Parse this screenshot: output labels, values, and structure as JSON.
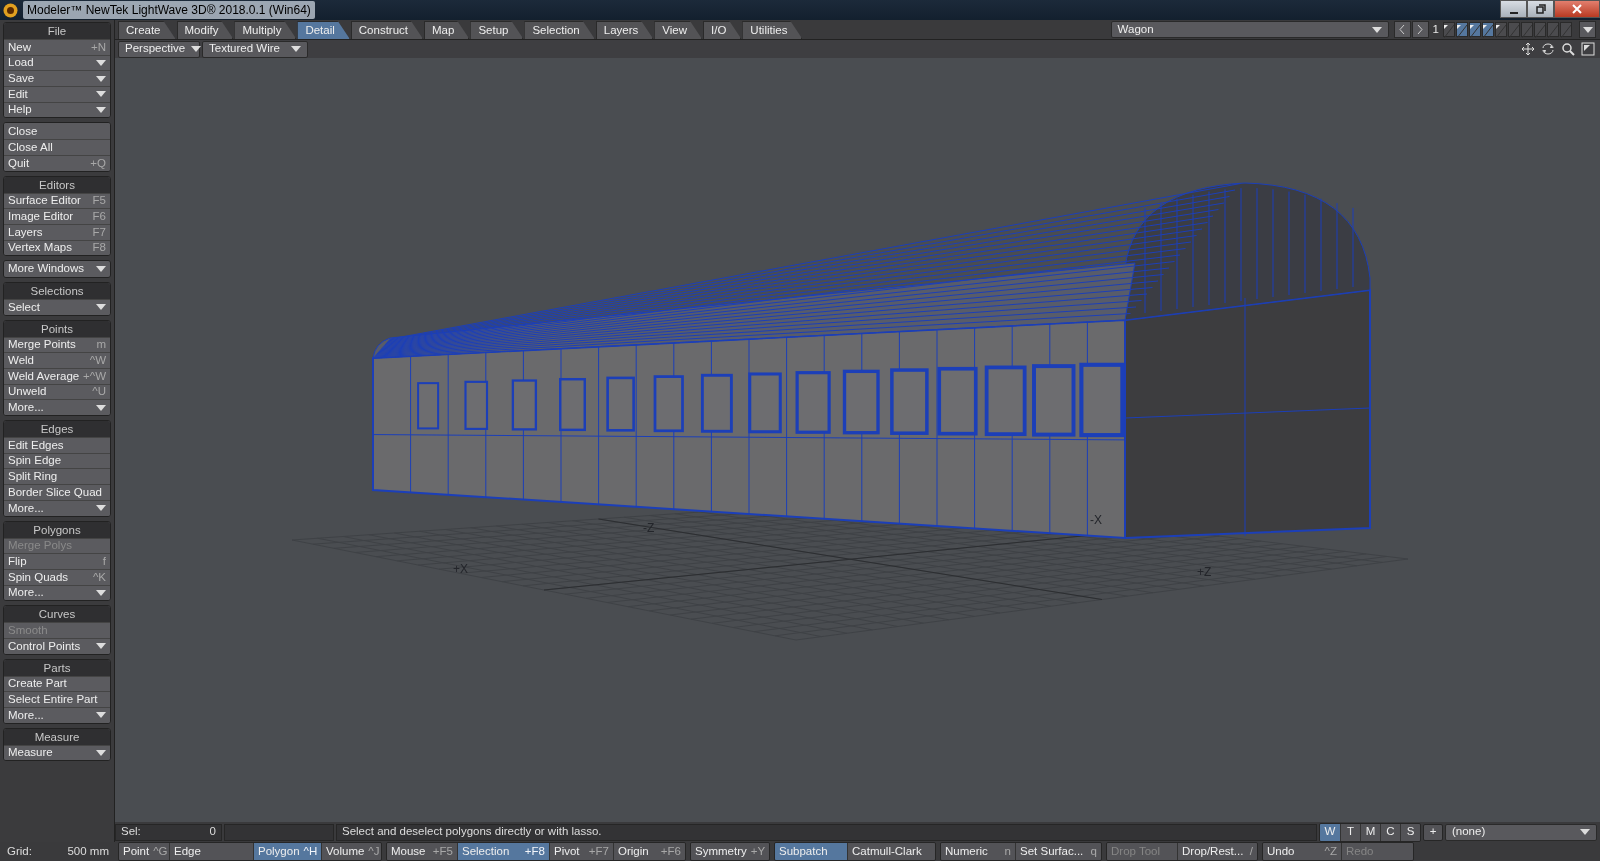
{
  "window": {
    "title": "Modeler™ NewTek LightWave 3D® 2018.0.1 (Win64)"
  },
  "tabs": [
    {
      "label": "Create",
      "selected": false
    },
    {
      "label": "Modify",
      "selected": false
    },
    {
      "label": "Multiply",
      "selected": false
    },
    {
      "label": "Detail",
      "selected": true
    },
    {
      "label": "Construct",
      "selected": false
    },
    {
      "label": "Map",
      "selected": false
    },
    {
      "label": "Setup",
      "selected": false
    },
    {
      "label": "Selection",
      "selected": false
    },
    {
      "label": "Layers",
      "selected": false
    },
    {
      "label": "View",
      "selected": false
    },
    {
      "label": "I/O",
      "selected": false
    },
    {
      "label": "Utilities",
      "selected": false
    }
  ],
  "object_selector": {
    "value": "Wagon"
  },
  "layer_bank": "1",
  "layer_slots": [
    {
      "foreground": false,
      "has_data": true
    },
    {
      "foreground": true,
      "has_data": true
    },
    {
      "foreground": true,
      "has_data": true
    },
    {
      "foreground": true,
      "has_data": true
    },
    {
      "foreground": false,
      "has_data": true
    },
    {
      "foreground": false,
      "has_data": false
    },
    {
      "foreground": false,
      "has_data": false
    },
    {
      "foreground": false,
      "has_data": false
    },
    {
      "foreground": false,
      "has_data": false
    },
    {
      "foreground": false,
      "has_data": false
    }
  ],
  "viewport": {
    "view": "Perspective",
    "render_mode": "Textured Wire",
    "axis_labels": [
      "-Z",
      "-X",
      "+X",
      "+Z"
    ]
  },
  "sidebar": [
    {
      "title": "File",
      "items": [
        {
          "label": "New",
          "shortcut": "+N",
          "kind": "button",
          "disabled": false
        },
        {
          "label": "Load",
          "kind": "menu",
          "disabled": false
        },
        {
          "label": "Save",
          "kind": "menu",
          "disabled": false
        },
        {
          "label": "Edit",
          "kind": "menu",
          "disabled": false
        },
        {
          "label": "Help",
          "kind": "menu",
          "disabled": false
        }
      ]
    },
    {
      "items": [
        {
          "label": "Close",
          "kind": "button",
          "disabled": false
        },
        {
          "label": "Close All",
          "kind": "button",
          "disabled": false
        },
        {
          "label": "Quit",
          "shortcut": "+Q",
          "kind": "button",
          "disabled": false
        }
      ]
    },
    {
      "title": "Editors",
      "items": [
        {
          "label": "Surface Editor",
          "shortcut": "F5",
          "kind": "button",
          "disabled": false
        },
        {
          "label": "Image Editor",
          "shortcut": "F6",
          "kind": "button",
          "disabled": false
        },
        {
          "label": "Layers",
          "shortcut": "F7",
          "kind": "button",
          "disabled": false
        },
        {
          "label": "Vertex Maps",
          "shortcut": "F8",
          "kind": "button",
          "disabled": false
        }
      ]
    },
    {
      "items": [
        {
          "label": "More Windows",
          "kind": "menu",
          "disabled": false
        }
      ]
    },
    {
      "title": "Selections",
      "items": [
        {
          "label": "Select",
          "kind": "menu",
          "disabled": false
        }
      ]
    },
    {
      "title": "Points",
      "items": [
        {
          "label": "Merge Points",
          "shortcut": "m",
          "kind": "button",
          "disabled": false
        },
        {
          "label": "Weld",
          "shortcut": "^W",
          "kind": "button",
          "disabled": false
        },
        {
          "label": "Weld Average",
          "shortcut": "+^W",
          "kind": "button",
          "disabled": false
        },
        {
          "label": "Unweld",
          "shortcut": "^U",
          "kind": "button",
          "disabled": false
        },
        {
          "label": "More...",
          "kind": "menu",
          "disabled": false
        }
      ]
    },
    {
      "title": "Edges",
      "items": [
        {
          "label": "Edit Edges",
          "kind": "button",
          "disabled": false
        },
        {
          "label": "Spin Edge",
          "kind": "button",
          "disabled": false
        },
        {
          "label": "Split Ring",
          "kind": "button",
          "disabled": false
        },
        {
          "label": "Border Slice Quad",
          "kind": "button",
          "disabled": false
        },
        {
          "label": "More...",
          "kind": "menu",
          "disabled": false
        }
      ]
    },
    {
      "title": "Polygons",
      "items": [
        {
          "label": "Merge Polys",
          "kind": "button",
          "disabled": true
        },
        {
          "label": "Flip",
          "shortcut": "f",
          "kind": "button",
          "disabled": false
        },
        {
          "label": "Spin Quads",
          "shortcut": "^K",
          "kind": "button",
          "disabled": false
        },
        {
          "label": "More...",
          "kind": "menu",
          "disabled": false
        }
      ]
    },
    {
      "title": "Curves",
      "items": [
        {
          "label": "Smooth",
          "kind": "button",
          "disabled": true
        },
        {
          "label": "Control Points",
          "kind": "menu",
          "disabled": false
        }
      ]
    },
    {
      "title": "Parts",
      "items": [
        {
          "label": "Create Part",
          "kind": "button",
          "disabled": false
        },
        {
          "label": "Select Entire Part",
          "kind": "button",
          "disabled": false
        },
        {
          "label": "More...",
          "kind": "menu",
          "disabled": false
        }
      ]
    },
    {
      "title": "Measure",
      "items": [
        {
          "label": "Measure",
          "kind": "menu",
          "disabled": false
        }
      ]
    }
  ],
  "status": {
    "sel_label": "Sel:",
    "sel_value": "0",
    "message": "Select and deselect polygons directly or with lasso."
  },
  "view_toggles": [
    {
      "label": "W",
      "selected": true
    },
    {
      "label": "T",
      "selected": false
    },
    {
      "label": "M",
      "selected": false
    },
    {
      "label": "C",
      "selected": false
    },
    {
      "label": "S",
      "selected": false
    }
  ],
  "add_button": "+",
  "surface_selector": {
    "value": "(none)"
  },
  "grid": {
    "label": "Grid:",
    "value": "500 mm"
  },
  "bottom_groups": [
    [
      {
        "label": "Point",
        "shortcut": "^G",
        "selected": false,
        "disabled": false
      },
      {
        "label": "Edge",
        "selected": false,
        "disabled": false
      },
      {
        "label": "Polygon",
        "shortcut": "^H",
        "selected": true,
        "disabled": false
      },
      {
        "label": "Volume",
        "shortcut": "^J",
        "selected": false,
        "disabled": false
      }
    ],
    [
      {
        "label": "Mouse",
        "shortcut": "+F5",
        "selected": false,
        "disabled": false
      },
      {
        "label": "Selection",
        "shortcut": "+F8",
        "selected": true,
        "disabled": false
      },
      {
        "label": "Pivot",
        "shortcut": "+F7",
        "selected": false,
        "disabled": false
      },
      {
        "label": "Origin",
        "shortcut": "+F6",
        "selected": false,
        "disabled": false
      }
    ],
    [
      {
        "label": "Symmetry",
        "shortcut": "+Y",
        "selected": false,
        "disabled": false
      }
    ],
    [
      {
        "label": "Subpatch",
        "selected": true,
        "disabled": false
      },
      {
        "label": "Catmull-Clark",
        "selected": false,
        "disabled": false
      }
    ],
    [
      {
        "label": "Numeric",
        "shortcut": "n",
        "selected": false,
        "disabled": false
      },
      {
        "label": "Set Surfac...",
        "shortcut": "q",
        "selected": false,
        "disabled": false
      }
    ],
    [
      {
        "label": "Drop Tool",
        "selected": false,
        "disabled": true
      },
      {
        "label": "Drop/Rest...",
        "shortcut": "/",
        "selected": false,
        "disabled": false
      }
    ],
    [
      {
        "label": "Undo",
        "shortcut": "^Z",
        "selected": false,
        "disabled": false
      },
      {
        "label": "Redo",
        "selected": false,
        "disabled": true
      }
    ]
  ]
}
